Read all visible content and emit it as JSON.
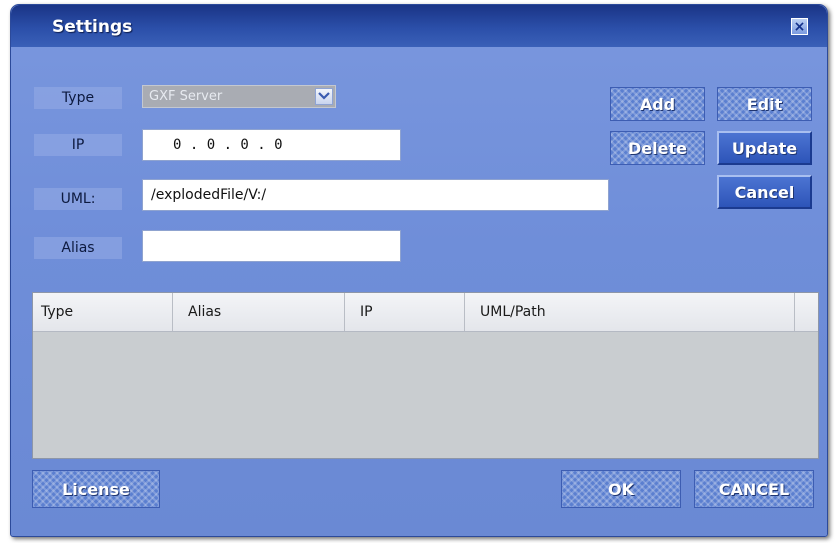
{
  "window": {
    "title": "Settings",
    "close_glyph": "×"
  },
  "form": {
    "type_label": "Type",
    "type_value": "GXF Server",
    "ip_label": "IP",
    "ip_value": "0 . 0 . 0 . 0",
    "uml_label": "UML:",
    "uml_value": "/explodedFile/V:/",
    "alias_label": "Alias",
    "alias_value": ""
  },
  "buttons": {
    "add": "Add",
    "edit": "Edit",
    "delete": "Delete",
    "update": "Update",
    "cancel": "Cancel",
    "license": "License",
    "ok": "OK",
    "cancel_dialog": "CANCEL"
  },
  "table": {
    "columns": [
      "Type",
      "Alias",
      "IP",
      "UML/Path"
    ],
    "rows": []
  },
  "icons": {
    "dropdown": "chevron-down-icon",
    "close": "close-icon"
  },
  "colors": {
    "title_bar": "#1a3486",
    "body": "#7a97de",
    "button": "#2d54b8"
  }
}
